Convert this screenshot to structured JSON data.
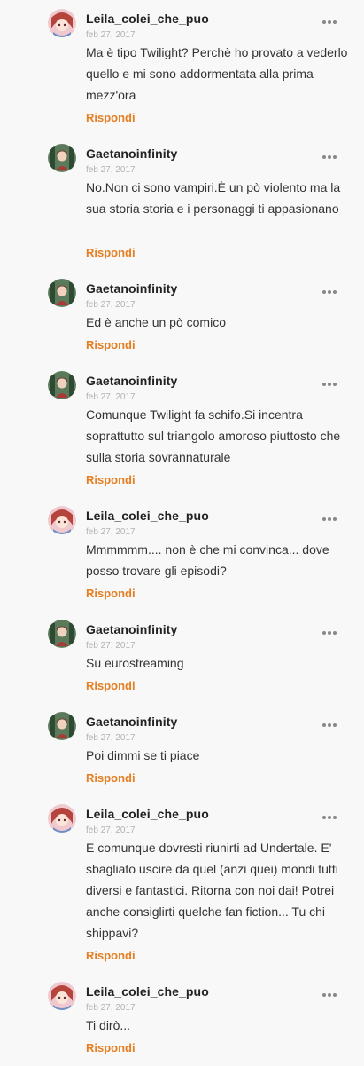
{
  "reply_label": "Rispondi",
  "icons": {
    "more": "more-options-icon",
    "avatar_leila": "pink-anime-avatar",
    "avatar_gaetano": "forest-character-avatar"
  },
  "colors": {
    "reply": "#e67e22",
    "date": "#b2b2b2",
    "username": "#222222",
    "background": "#f8f8f8"
  },
  "comments": [
    {
      "user": "Leila_colei_che_puo",
      "date": "feb 27, 2017",
      "text": "Ma è tipo Twilight? Perchè ho provato a vederlo quello e mi sono addormentata alla prima mezz'ora"
    },
    {
      "user": "Gaetanoinfinity",
      "date": "feb 27, 2017",
      "text": "No.Non ci sono vampiri.È un pò violento ma la sua storia storia e i personaggi ti appasionano"
    },
    {
      "user": "Gaetanoinfinity",
      "date": "feb 27, 2017",
      "text": "Ed è anche un pò comico"
    },
    {
      "user": "Gaetanoinfinity",
      "date": "feb 27, 2017",
      "text": "Comunque Twilight fa schifo.Si incentra soprattutto sul triangolo amoroso piuttosto che sulla storia sovrannaturale"
    },
    {
      "user": "Leila_colei_che_puo",
      "date": "feb 27, 2017",
      "text": "Mmmmmm.... non è che mi convinca... dove posso trovare gli episodi?"
    },
    {
      "user": "Gaetanoinfinity",
      "date": "feb 27, 2017",
      "text": "Su eurostreaming"
    },
    {
      "user": "Gaetanoinfinity",
      "date": "feb 27, 2017",
      "text": "Poi dimmi se ti piace"
    },
    {
      "user": "Leila_colei_che_puo",
      "date": "feb 27, 2017",
      "text": "E comunque dovresti riunirti ad Undertale. E' sbagliato uscire da quel (anzi quei) mondi tutti diversi e fantastici. Ritorna con noi dai! Potrei anche consiglirti quelche fan fiction... Tu chi shippavi?"
    },
    {
      "user": "Leila_colei_che_puo",
      "date": "feb 27, 2017",
      "text": "Ti dirò..."
    }
  ]
}
